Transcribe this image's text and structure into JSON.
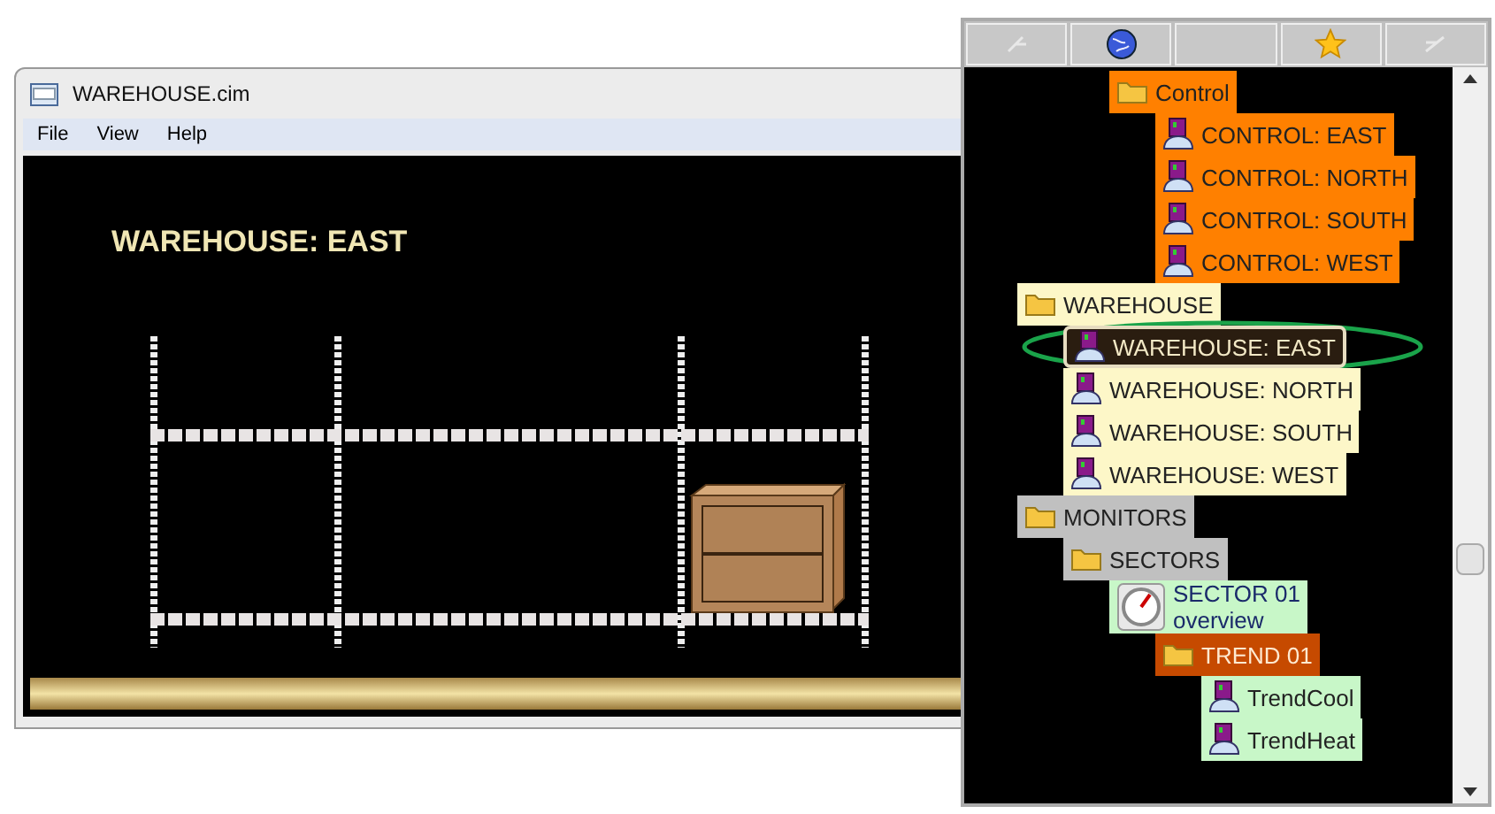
{
  "window": {
    "title": "WAREHOUSE.cim",
    "menu": [
      "File",
      "View",
      "Help"
    ],
    "screen_title": "WAREHOUSE: EAST"
  },
  "tree": {
    "partial_branch": [
      {
        "label": "Control",
        "kind": "folder",
        "color": "#ff8000",
        "selected": false,
        "children": [
          {
            "label": "CONTROL: EAST",
            "kind": "screen",
            "color": "#ff8000",
            "selected": false
          },
          {
            "label": "CONTROL: NORTH",
            "kind": "screen",
            "color": "#ff8000",
            "selected": false
          },
          {
            "label": "CONTROL: SOUTH",
            "kind": "screen",
            "color": "#ff8000",
            "selected": false
          },
          {
            "label": "CONTROL: WEST",
            "kind": "screen",
            "color": "#ff8000",
            "selected": false
          }
        ]
      }
    ],
    "items": [
      {
        "label": "WAREHOUSE",
        "kind": "folder",
        "color": "#fdf7c8",
        "selected": false,
        "children": [
          {
            "label": "WAREHOUSE: EAST",
            "kind": "screen",
            "color": "#2a1d10",
            "selected": true
          },
          {
            "label": "WAREHOUSE: NORTH",
            "kind": "screen",
            "color": "#fdf7c8",
            "selected": false
          },
          {
            "label": "WAREHOUSE: SOUTH",
            "kind": "screen",
            "color": "#fdf7c8",
            "selected": false
          },
          {
            "label": "WAREHOUSE: WEST",
            "kind": "screen",
            "color": "#fdf7c8",
            "selected": false
          }
        ]
      },
      {
        "label": "MONITORS",
        "kind": "folder",
        "color": "#c0c0c0",
        "selected": false,
        "children": [
          {
            "label": "SECTORS",
            "kind": "folder",
            "color": "#c0c0c0",
            "selected": false,
            "children": [
              {
                "label": "SECTOR 01",
                "sublabel": "overview",
                "kind": "gauge",
                "color": "#c8f7c8",
                "selected": false,
                "children": [
                  {
                    "label": "TREND 01",
                    "kind": "folder",
                    "color": "#c64a00",
                    "selected": false,
                    "children": [
                      {
                        "label": "TrendCool",
                        "kind": "screen",
                        "color": "#c8f7c8",
                        "selected": false
                      },
                      {
                        "label": "TrendHeat",
                        "kind": "screen",
                        "color": "#c8f7c8",
                        "selected": false
                      }
                    ]
                  }
                ]
              }
            ]
          }
        ]
      }
    ]
  }
}
